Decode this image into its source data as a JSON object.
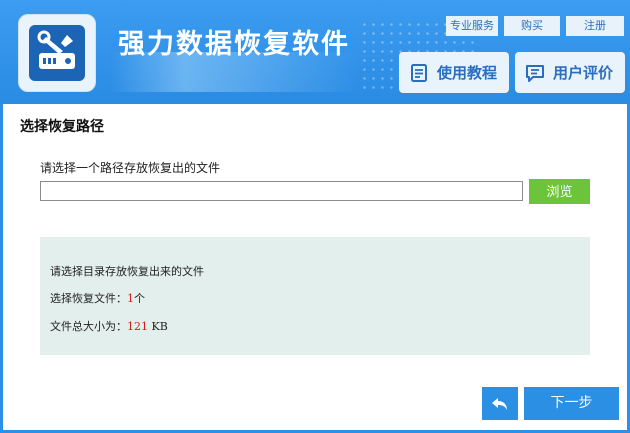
{
  "app": {
    "title": "强力数据恢复软件",
    "top_links": [
      "专业服务",
      "购买",
      "注册"
    ],
    "tutorial_label": "使用教程",
    "review_label": "用户评价"
  },
  "main": {
    "section_title": "选择恢复路径",
    "path_prompt": "请选择一个路径存放恢复出的文件",
    "path_value": "",
    "browse_label": "浏览",
    "info": {
      "heading": "请选择目录存放恢复出来的文件",
      "files_label": "选择恢复文件：",
      "files_count": "1",
      "files_unit": "个",
      "size_label": "文件总大小为：",
      "size_value": "121",
      "size_unit": " KB"
    },
    "next_label": "下一步"
  },
  "icons": {
    "logo": "hdd-wrench-icon",
    "tutorial": "document-icon",
    "review": "chat-icon",
    "back": "back-arrow-icon"
  },
  "colors": {
    "header_blue": "#2f8fe6",
    "browse_green": "#6cc43a",
    "accent_red": "#d41c1c",
    "info_bg": "#e3efec"
  }
}
